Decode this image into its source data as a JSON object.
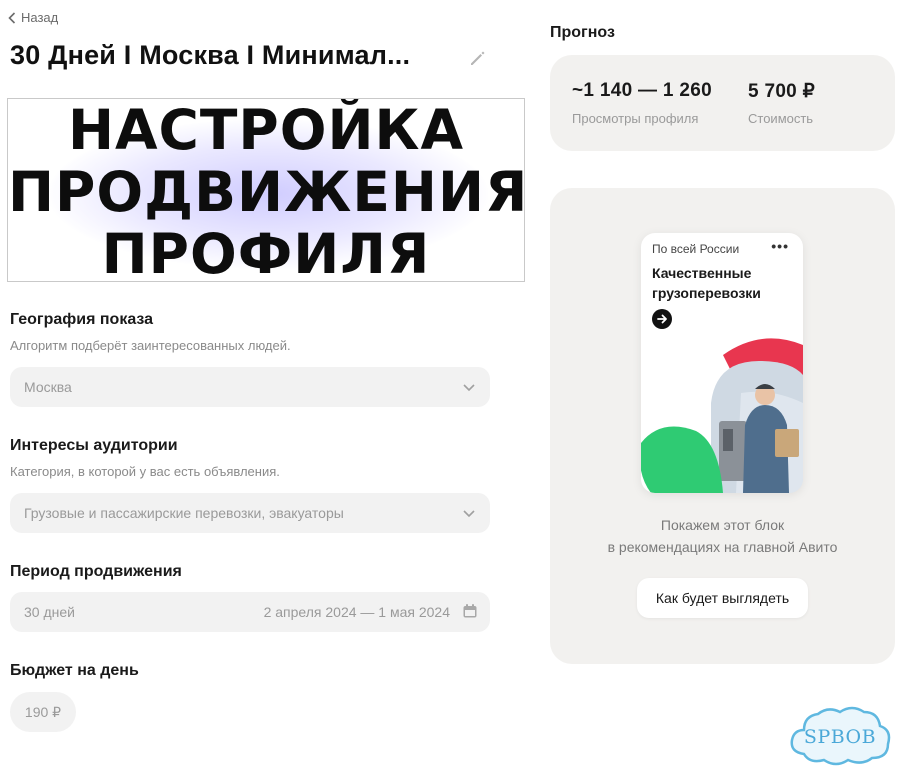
{
  "header": {
    "back_label": "Назад",
    "title": "30 Дней I Москва I Минимал..."
  },
  "banner": {
    "lines": [
      "НАСТРОЙКА",
      "ПРОДВИЖЕНИЯ",
      "ПРОФИЛЯ"
    ]
  },
  "geography": {
    "title": "География показа",
    "hint": "Алгоритм подберёт заинтересованных людей.",
    "value": "Москва"
  },
  "interests": {
    "title": "Интересы аудитории",
    "hint": "Категория, в которой у вас есть объявления.",
    "value": "Грузовые и пассажирские перевозки, эвакуаторы"
  },
  "period": {
    "title": "Период продвижения",
    "value": "30 дней",
    "range": "2 апреля 2024 — 1 мая 2024"
  },
  "budget": {
    "title": "Бюджет на день",
    "value": "190 ₽"
  },
  "forecast": {
    "title": "Прогноз",
    "views_value": "~1 140 — 1 260",
    "views_label": "Просмотры профиля",
    "cost_value": "5 700 ₽",
    "cost_label": "Стоимость"
  },
  "preview": {
    "ad_region": "По всей России",
    "ad_title": "Качественные грузоперевозки",
    "caption_line1": "Покажем этот блок",
    "caption_line2": "в рекомендациях на главной Авито",
    "button_label": "Как будет выглядеть"
  },
  "watermark": {
    "text": "SPBOB"
  },
  "colors": {
    "card_bg": "#f2f1ef",
    "field_bg": "#f2f2f2",
    "accent_red": "#e8364f",
    "accent_green": "#2fcb73"
  }
}
